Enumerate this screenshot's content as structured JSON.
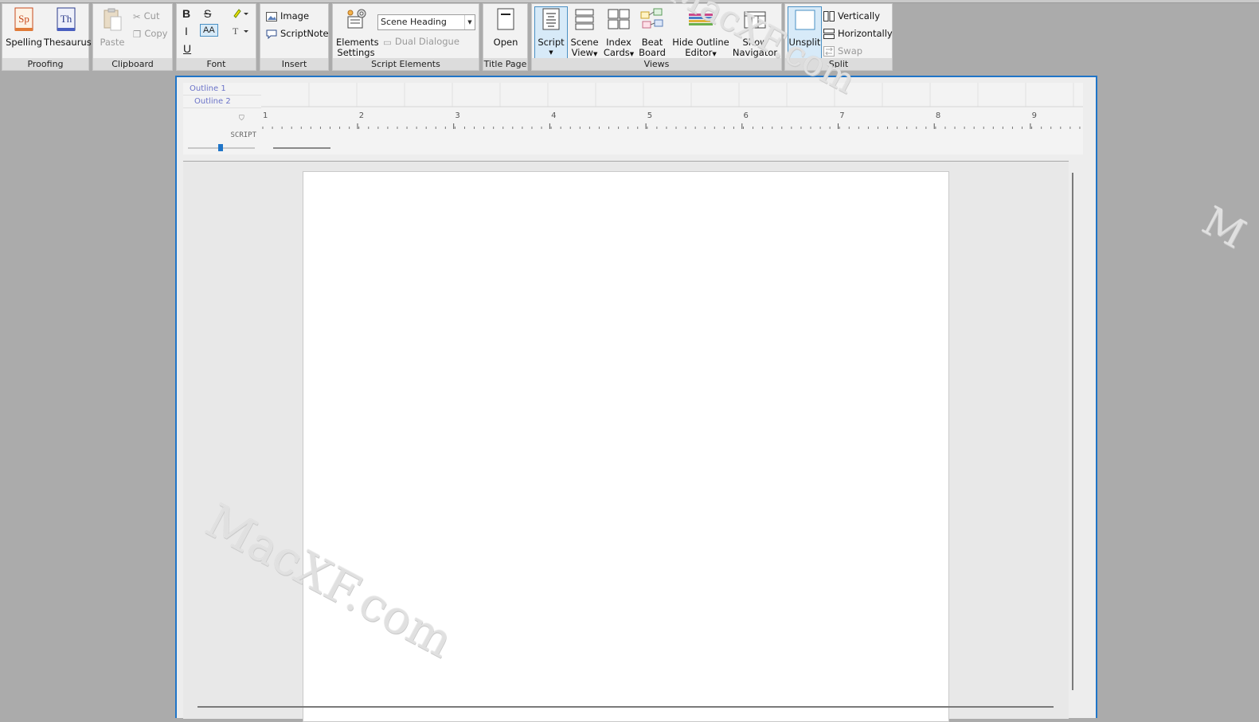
{
  "ribbon": {
    "groups": {
      "proofing": "Proofing",
      "clipboard": "Clipboard",
      "font": "Font",
      "insert": "Insert",
      "script_elements": "Script Elements",
      "title_page": "Title Page",
      "views": "Views",
      "split": "Split"
    },
    "proofing": {
      "spelling": "Spelling",
      "thesaurus": "Thesaurus",
      "sp_glyph": "Sp",
      "th_glyph": "Th"
    },
    "clipboard": {
      "paste": "Paste",
      "cut": "Cut",
      "copy": "Copy"
    },
    "font": {
      "bold": "B",
      "strike": "S",
      "italic": "I",
      "caps": "AA",
      "underline": "U"
    },
    "insert": {
      "image": "Image",
      "scriptnote": "ScriptNote"
    },
    "script_elements": {
      "elements_settings_line1": "Elements",
      "elements_settings_line2": "Settings",
      "element_select": "Scene Heading",
      "dual_dialogue": "Dual Dialogue"
    },
    "title_page": {
      "open": "Open"
    },
    "views": {
      "script": "Script",
      "scene_view_1": "Scene",
      "scene_view_2": "View",
      "index_cards_1": "Index",
      "index_cards_2": "Cards",
      "beat_board_1": "Beat",
      "beat_board_2": "Board",
      "hide_outline_1": "Hide Outline",
      "hide_outline_2": "Editor",
      "show_navigator_1": "Show",
      "show_navigator_2": "Navigator"
    },
    "split": {
      "unsplit": "Unsplit",
      "vertically": "Vertically",
      "horizontally": "Horizontally",
      "swap": "Swap"
    }
  },
  "outline": {
    "outline1": "Outline 1",
    "outline2": "Outline 2",
    "script_label": "SCRIPT"
  },
  "ruler": {
    "numbers": [
      "1",
      "2",
      "3",
      "4",
      "5",
      "6",
      "7",
      "8",
      "9"
    ]
  },
  "watermarks": {
    "main": "MacXF.com",
    "top": "MacXF.com",
    "right": "M"
  },
  "colors": {
    "frame_blue": "#1f75c8",
    "outline_text": "#6b73c8",
    "selected_bg": "#d7eaf8"
  }
}
